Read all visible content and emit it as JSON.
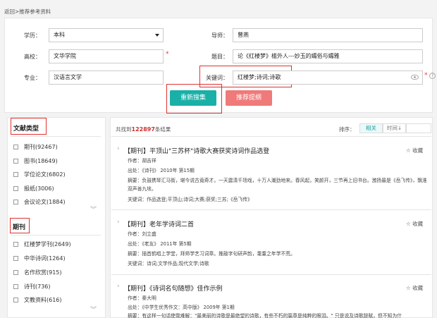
{
  "breadcrumb": {
    "back": "返回",
    "sep": ">",
    "current": "推荐参考资料"
  },
  "form": {
    "education": {
      "label": "学历：",
      "value": "本科"
    },
    "advisor": {
      "label": "导师：",
      "value": "曾燕"
    },
    "school": {
      "label": "高校：",
      "value": "文华学院",
      "required": "*"
    },
    "topic": {
      "label": "题目：",
      "value": "论《红楼梦》槛外人---妙玉的孀俗与孀雅"
    },
    "major": {
      "label": "专业：",
      "value": "汉语言文学"
    },
    "keywords": {
      "label": "关键词：",
      "value": "红楼梦;诗词;诗歌",
      "required": "*",
      "help": "?"
    },
    "search_button": "重新搜集",
    "recommend_button": "推荐提纲"
  },
  "filters": {
    "doc_type_title": "文献类型",
    "doc_types": [
      {
        "label": "期刊(92467)"
      },
      {
        "label": "图书(18649)"
      },
      {
        "label": "学位论文(6802)"
      },
      {
        "label": "报纸(3006)"
      },
      {
        "label": "会议论文(1884)"
      }
    ],
    "journal_title": "期刊",
    "journals": [
      {
        "label": "红楼梦学刊(2649)"
      },
      {
        "label": "中华诗词(1264)"
      },
      {
        "label": "名作欣赏(915)"
      },
      {
        "label": "诗刊(736)"
      },
      {
        "label": "文教资料(616)"
      }
    ]
  },
  "results": {
    "count_prefix": "共找到",
    "count": "122897",
    "count_suffix": "条结果",
    "sort_label": "排序：",
    "sort_relevance": "相关",
    "sort_time": "时间↓",
    "fav_label": "收藏",
    "items": [
      {
        "title": "【期刊】平顶山\"三苏杯\"诗歌大赛获奖诗词作品选登",
        "author": "作者：胡吉祥",
        "source": "出处：《诗刊》 2010年 第15期",
        "abstract": "摘要：负鼓携琴汇马街，堪今说古竟奇才。一天震清千场戏，十万人潮劲地来。春风起，笑颜开，三节再上旧书台。激扬最是《岳飞传》，飘淮双声善九垓。",
        "keywords": "关键词：作品选登;平顶山;诗词;大赛;获奖;三苏;《岳飞传》"
      },
      {
        "title": "【期刊】老年学诗词二首",
        "author": "作者：刘立盛",
        "source": "出处：《老友》 2011年 第5期",
        "abstract": "摘要：插首鹤唱上学堂，拜师学艺习词章。推敲字句研声韵，耄耋之年学不荒。",
        "keywords": "关键词：诗词;文学作品;现代文学;诗歌"
      },
      {
        "title": "【期刊】《诗词名句随想》佳作示例",
        "author": "作者：秦大明",
        "source": "出处：《中学生优秀作文：高中版》 2009年 第1期",
        "abstract": "摘要：有这样一句话使我难解：\"最美丽的诗歌是最绝望的诗歌，有些不朽的篇章是纯粹的眼泪。\" 只是说及诗歌辞赋，但不知为什"
      }
    ]
  }
}
